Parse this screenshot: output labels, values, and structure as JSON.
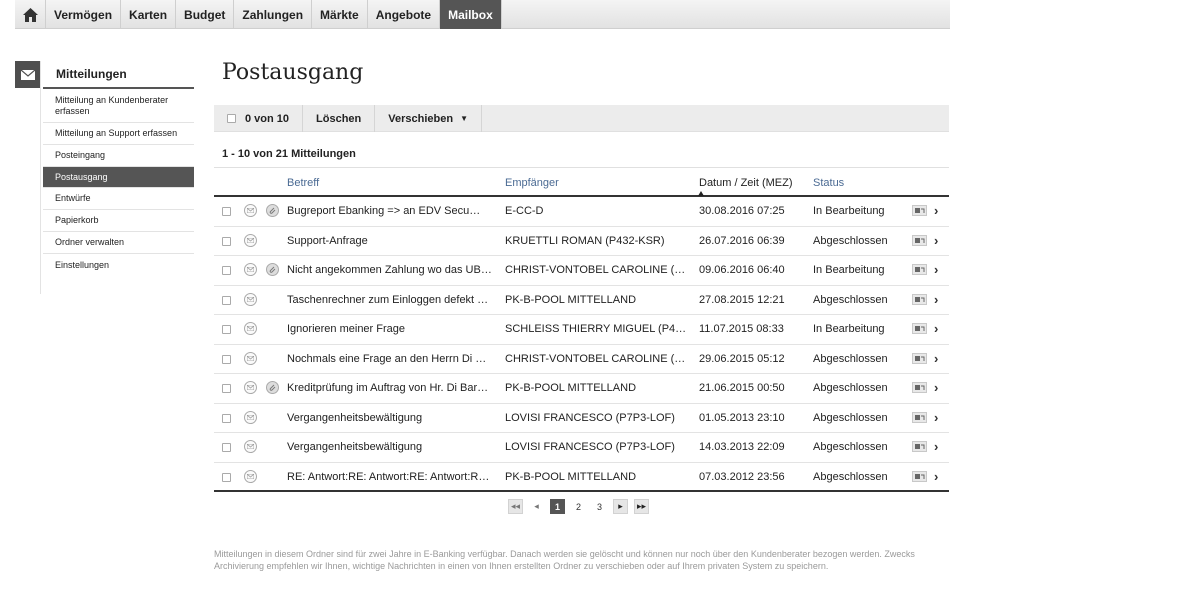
{
  "nav": {
    "home_icon": "home-icon",
    "items": [
      "Vermögen",
      "Karten",
      "Budget",
      "Zahlungen",
      "Märkte",
      "Angebote",
      "Mailbox"
    ],
    "active": "Mailbox"
  },
  "sidebar": {
    "icon": "envelope-icon",
    "title": "Mitteilungen",
    "items": [
      {
        "label": "Mitteilung an Kundenberater erfassen"
      },
      {
        "label": "Mitteilung an Support erfassen"
      },
      {
        "label": "Posteingang"
      },
      {
        "label": "Postausgang"
      },
      {
        "label": "Entwürfe"
      },
      {
        "label": "Papierkorb"
      },
      {
        "label": "Ordner verwalten"
      },
      {
        "label": "Einstellungen"
      }
    ],
    "active": "Postausgang"
  },
  "page_title": "Postausgang",
  "toolbar": {
    "selected": "0 von 10",
    "delete_label": "Löschen",
    "move_label": "Verschieben"
  },
  "count_text": "1 - 10 von 21 Mitteilungen",
  "table": {
    "headers": {
      "subject": "Betreff",
      "recipient": "Empfänger",
      "date": "Datum / Zeit (MEZ)",
      "status": "Status"
    },
    "rows": [
      {
        "subject": "Bugreport Ebanking => an EDV Secu…",
        "recipient": "E-CC-D",
        "date": "30.08.2016 07:25",
        "status": "In Bearbeitung",
        "attachment": true
      },
      {
        "subject": "Support-Anfrage",
        "recipient": "KRUETTLI ROMAN (P432-KSR)",
        "date": "26.07.2016 06:39",
        "status": "Abgeschlossen",
        "attachment": false
      },
      {
        "subject": "Nicht angekommen Zahlung wo das UB…",
        "recipient": "CHRIST-VONTOBEL CAROLINE (…",
        "date": "09.06.2016 06:40",
        "status": "In Bearbeitung",
        "attachment": true
      },
      {
        "subject": "Taschenrechner zum Einloggen defekt …",
        "recipient": "PK-B-POOL MITTELLAND",
        "date": "27.08.2015 12:21",
        "status": "Abgeschlossen",
        "attachment": false
      },
      {
        "subject": "Ignorieren meiner Frage",
        "recipient": "SCHLEISS THIERRY MIGUEL (P4…",
        "date": "11.07.2015 08:33",
        "status": "In Bearbeitung",
        "attachment": false
      },
      {
        "subject": "Nochmals eine Frage an den Herrn Di …",
        "recipient": "CHRIST-VONTOBEL CAROLINE (…",
        "date": "29.06.2015 05:12",
        "status": "Abgeschlossen",
        "attachment": false
      },
      {
        "subject": "Kreditprüfung im Auftrag von Hr. Di Bar…",
        "recipient": "PK-B-POOL MITTELLAND",
        "date": "21.06.2015 00:50",
        "status": "Abgeschlossen",
        "attachment": true
      },
      {
        "subject": "Vergangenheitsbewältigung",
        "recipient": "LOVISI FRANCESCO (P7P3-LOF)",
        "date": "01.05.2013 23:10",
        "status": "Abgeschlossen",
        "attachment": false
      },
      {
        "subject": "Vergangenheitsbewältigung",
        "recipient": "LOVISI FRANCESCO (P7P3-LOF)",
        "date": "14.03.2013 22:09",
        "status": "Abgeschlossen",
        "attachment": false
      },
      {
        "subject": "RE: Antwort:RE: Antwort:RE: Antwort:R…",
        "recipient": "PK-B-POOL MITTELLAND",
        "date": "07.03.2012 23:56",
        "status": "Abgeschlossen",
        "attachment": false
      }
    ]
  },
  "pager": {
    "pages": [
      "1",
      "2",
      "3"
    ],
    "current": "1"
  },
  "footer": "Mitteilungen in diesem Ordner sind für zwei Jahre in E-Banking verfügbar. Danach werden sie gelöscht und können nur noch über den Kundenberater bezogen werden. Zwecks Archivierung empfehlen wir Ihnen, wichtige Nachrichten in einen von Ihnen erstellten Ordner zu verschieben oder auf Ihrem privaten System zu speichern."
}
